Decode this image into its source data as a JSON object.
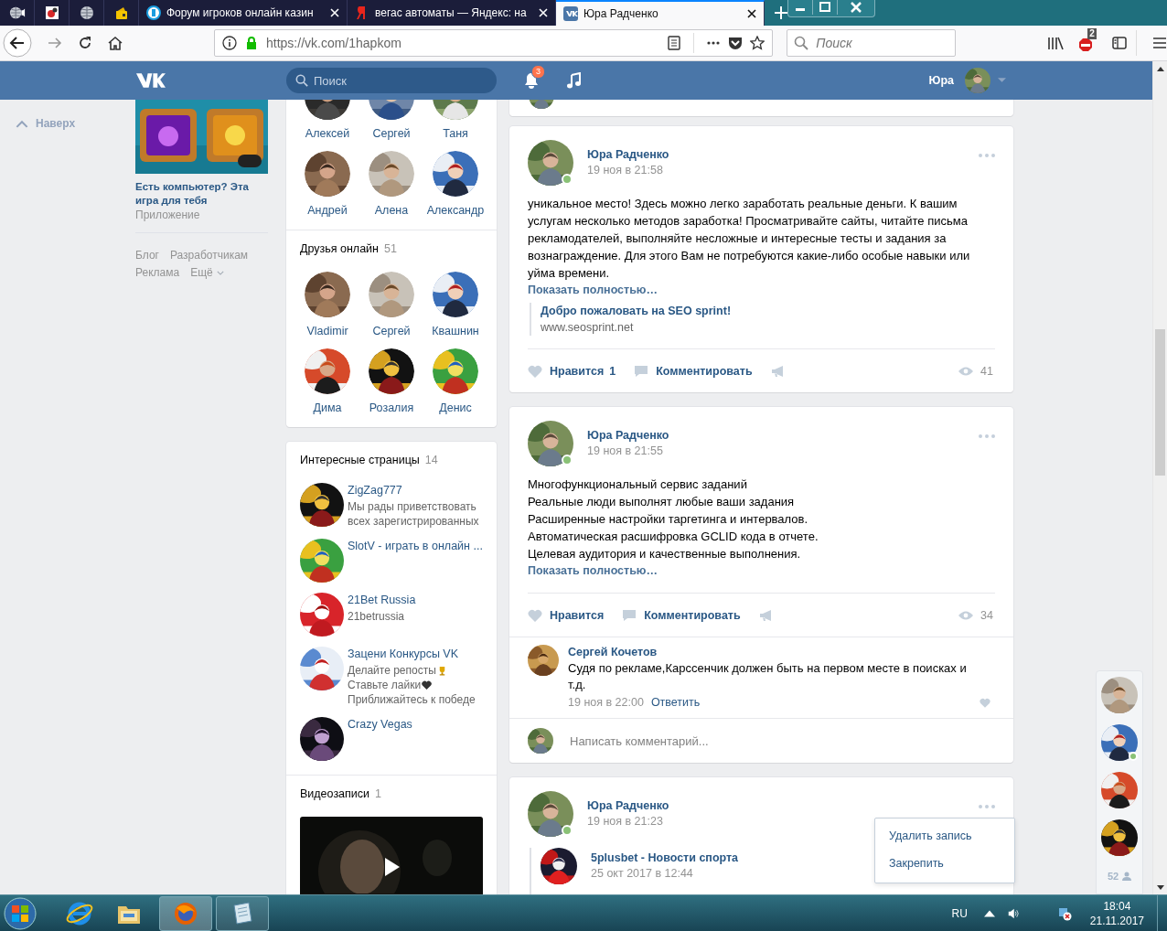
{
  "browser": {
    "tabs": [
      {
        "title": "Форум игроков онлайн казин",
        "selected": false,
        "kind": "forum"
      },
      {
        "title": "вегас автоматы — Яндекс: на",
        "selected": false,
        "kind": "search"
      },
      {
        "title": "Юра Радченко",
        "selected": true,
        "kind": "social"
      }
    ],
    "url": "https://vk.com/1hapkom",
    "search_placeholder": "Поиск",
    "adblock_count": "2"
  },
  "header": {
    "search_placeholder": "Поиск",
    "notifications": "3",
    "user_name": "Юра"
  },
  "left": {
    "back_to_top": "Наверх",
    "ad_title": "Есть компьютер? Эта игра для тебя",
    "ad_subtitle": "Приложение",
    "links": [
      "Блог",
      "Разработчикам",
      "Реклама",
      "Ещё"
    ]
  },
  "friends": {
    "items": [
      {
        "name": "Алексей"
      },
      {
        "name": "Сергей"
      },
      {
        "name": "Таня"
      },
      {
        "name": "Андрей"
      },
      {
        "name": "Алена"
      },
      {
        "name": "Александр"
      }
    ]
  },
  "friends_online": {
    "title": "Друзья онлайн",
    "count": "51",
    "items": [
      {
        "name": "Vladimir"
      },
      {
        "name": "Сергей"
      },
      {
        "name": "Квашнин"
      },
      {
        "name": "Дима"
      },
      {
        "name": "Розалия"
      },
      {
        "name": "Денис"
      }
    ]
  },
  "pages": {
    "title": "Интересные страницы",
    "count": "14",
    "items": [
      {
        "name": "ZigZag777",
        "lines": [
          {
            "text": "Мы рады приветствовать всех зарегистрированных"
          }
        ]
      },
      {
        "name": "SlotV - играть в онлайн ..."
      },
      {
        "name": "21Bet Russia",
        "lines": [
          {
            "text": "21betrussia"
          }
        ]
      },
      {
        "name": "Зацени Конкурсы VK",
        "lines": [
          {
            "text": "Делайте репосты",
            "kind": "trophy"
          },
          {
            "text": "Ставьте лайки",
            "kind": "heart"
          },
          {
            "text": "Приближайтесь к победе"
          }
        ]
      },
      {
        "name": "Crazy Vegas"
      }
    ]
  },
  "videos": {
    "title": "Видеозаписи",
    "count": "1"
  },
  "posts": [
    {
      "author": "Юра Радченко",
      "date": "19 ноя в 21:58",
      "online": true,
      "text": "уникальное место! Здесь можно легко заработать реальные деньги. К вашим услугам несколько методов заработка! Просматривайте сайты, читайте письма рекламодателей, выполняйте несложные и интересные тесты и задания за вознаграждение. Для этого Вам не потребуются какие-либо особые навыки или уйма времени.",
      "more": "Показать полностью…",
      "attachment": {
        "title": "Добро пожаловать на SEO sprint!",
        "url": "www.seosprint.net"
      },
      "actions": {
        "like": "Нравится",
        "like_count": "1",
        "comment": "Комментировать",
        "views": "41"
      }
    },
    {
      "author": "Юра Радченко",
      "date": "19 ноя в 21:55",
      "online": true,
      "text": "Многофункциональный сервис заданий\nРеальные люди выполнят любые ваши задания\nРасширенные настройки таргетинга и интервалов.\nАвтоматическая расшифровка GCLID кода в отчете.\nЦелевая аудитория и качественные выполнения.",
      "more": "Показать полностью…",
      "actions": {
        "like": "Нравится",
        "comment": "Комментировать",
        "views": "34"
      },
      "comments": [
        {
          "author": "Сергей Кочетов",
          "text": "Судя по рекламе,Карссенчик должен быть на первом месте в поисках и т.д.",
          "date": "19 ноя в 22:00",
          "reply": "Ответить"
        }
      ],
      "comment_placeholder": "Написать комментарий..."
    },
    {
      "author": "Юра Радченко",
      "date": "19 ноя в 21:23",
      "online": true,
      "repost": {
        "author": "5plusbet - Новости спорта",
        "date": "25 окт 2017 в 12:44"
      },
      "menu": [
        "Удалить запись",
        "Закрепить"
      ]
    }
  ],
  "chat": {
    "count": "52",
    "contacts": [
      {
        "online": false
      },
      {
        "online": true
      },
      {
        "online": false
      },
      {
        "online": false
      }
    ]
  },
  "taskbar": {
    "language": "RU",
    "time": "18:04",
    "date": "21.11.2017"
  }
}
